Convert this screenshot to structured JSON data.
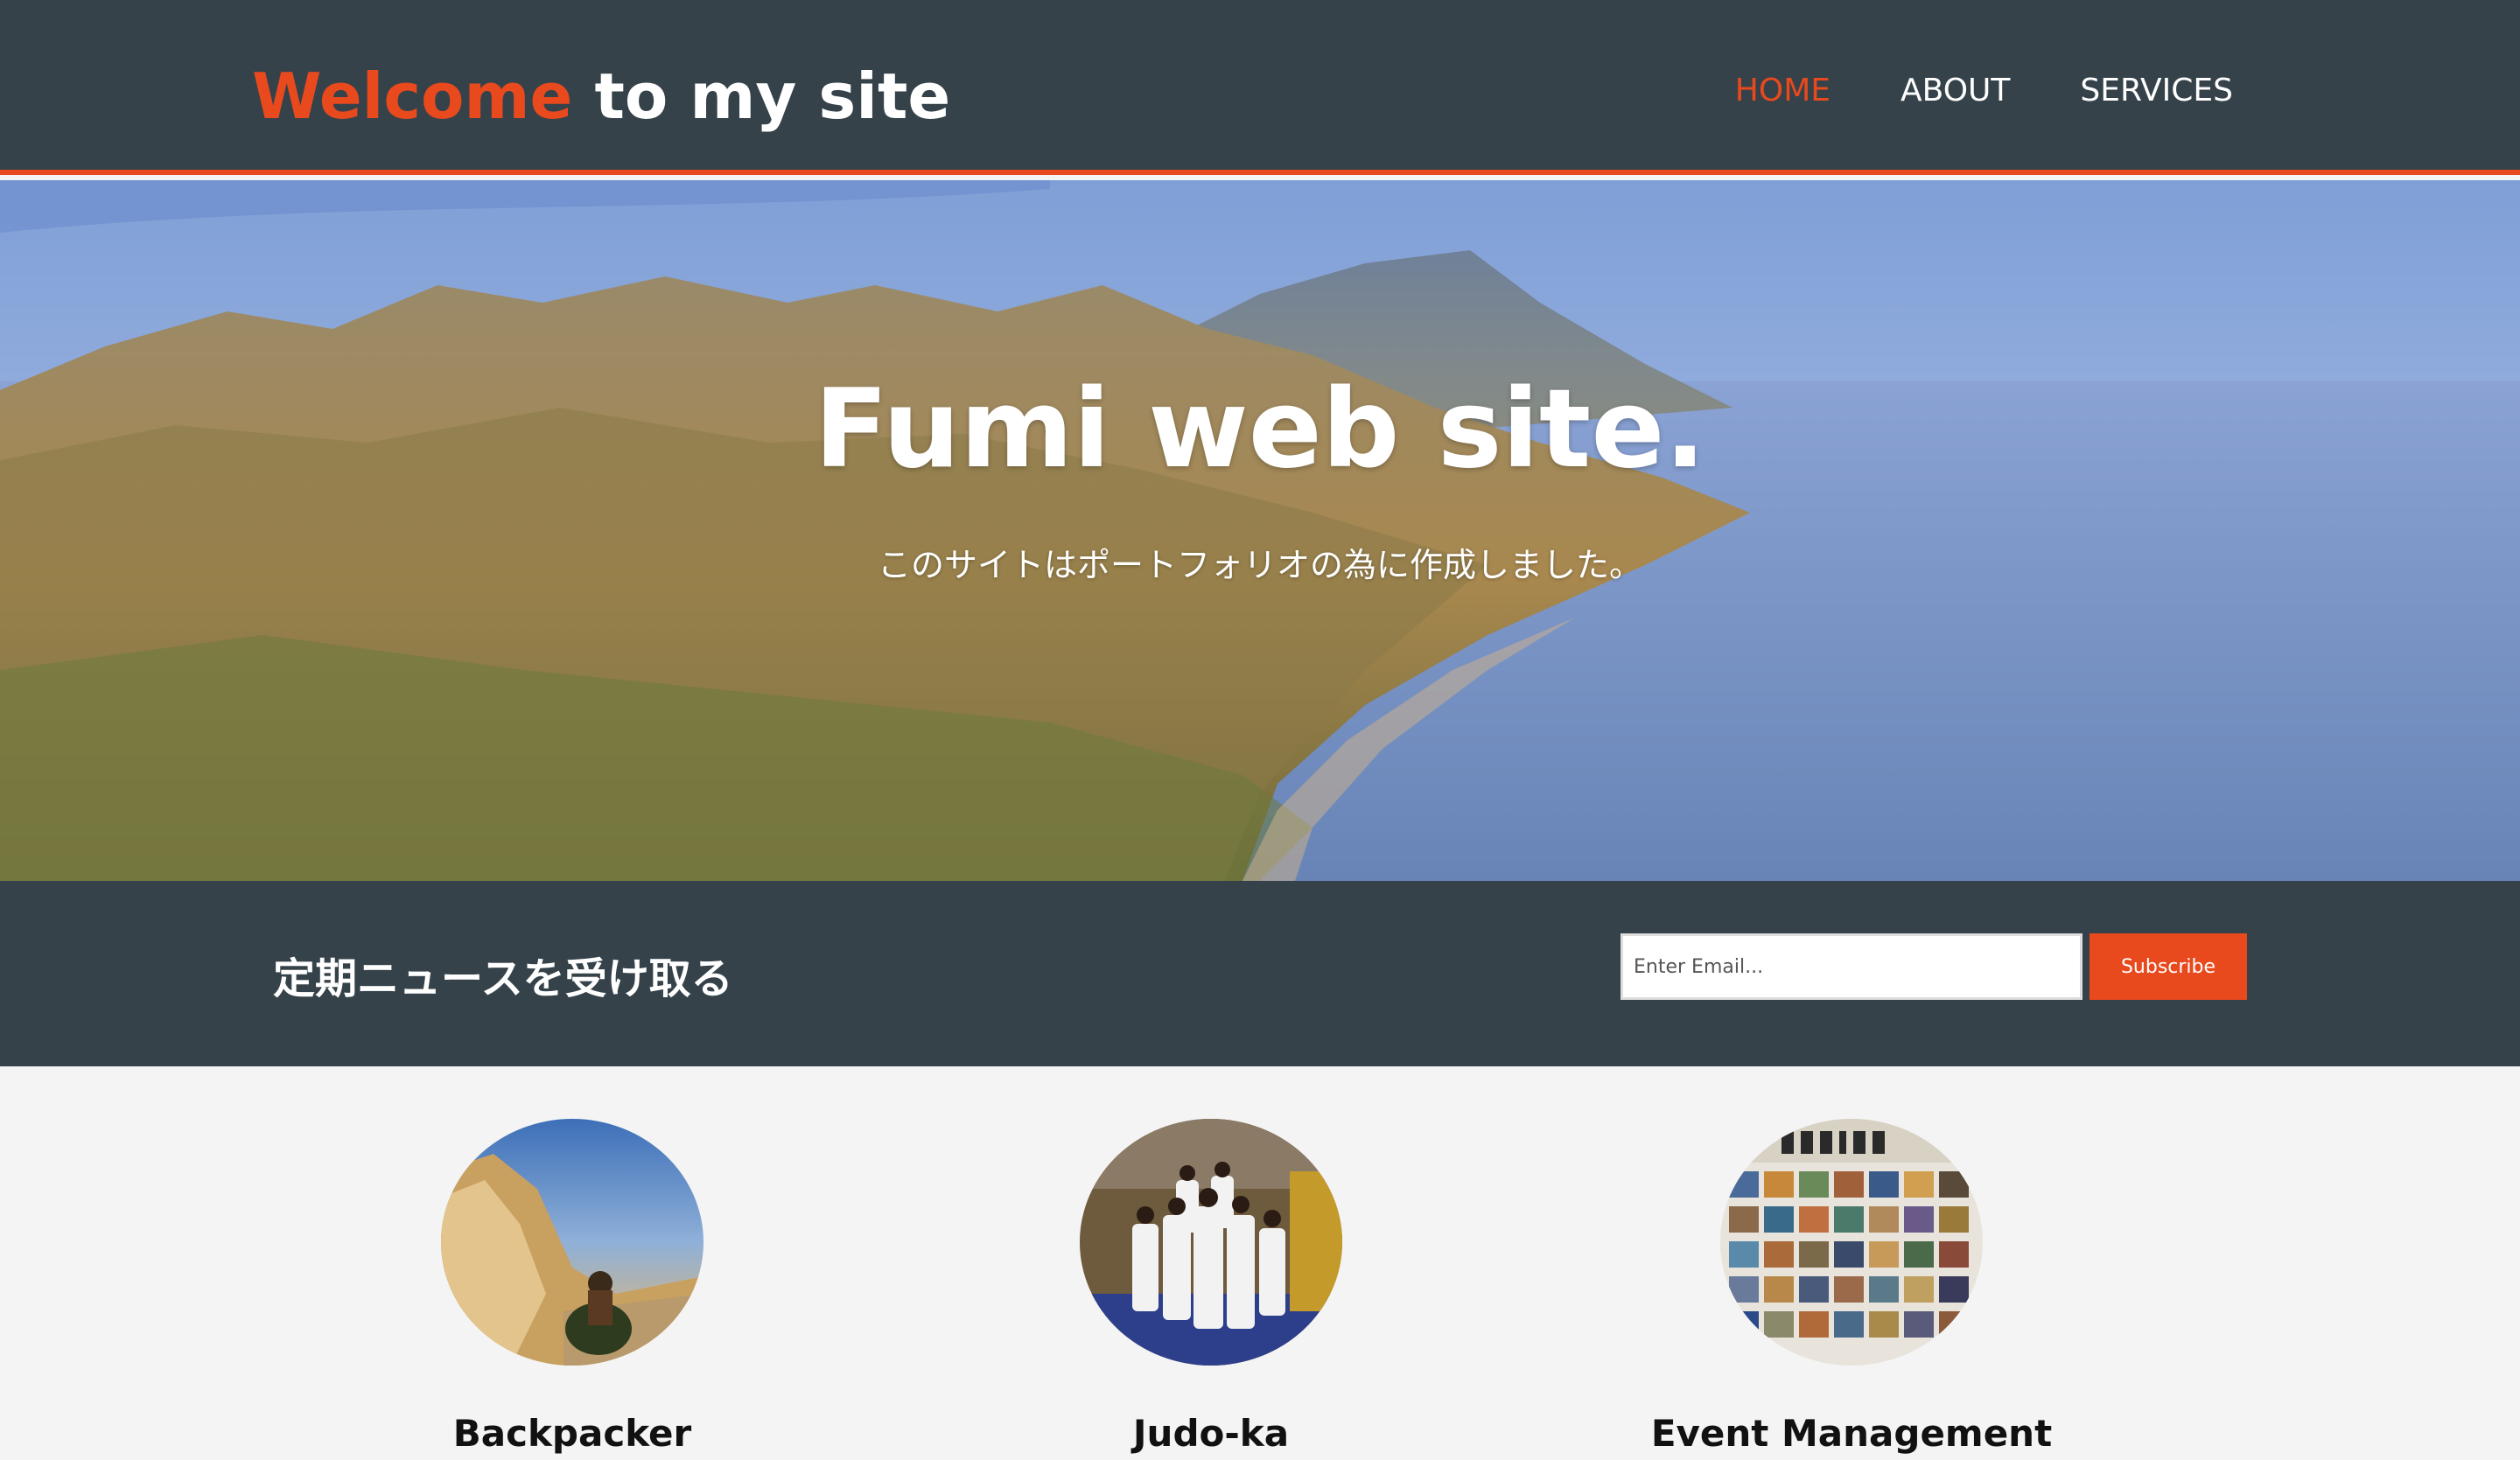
{
  "header": {
    "logo_highlight": "Welcome",
    "logo_rest": " to my site",
    "nav": [
      {
        "label": "HOME",
        "current": true
      },
      {
        "label": "ABOUT",
        "current": false
      },
      {
        "label": "SERVICES",
        "current": false
      }
    ]
  },
  "showcase": {
    "title": "Fumi web site.",
    "subtitle": "このサイトはポートフォリオの為に作成しました。"
  },
  "newsletter": {
    "heading": "定期ニュースを受け取る",
    "email_placeholder": "Enter Email...",
    "subscribe_label": "Subscribe"
  },
  "boxes": [
    {
      "title": "Backpacker",
      "icon": "backpacker-photo"
    },
    {
      "title": "Judo-ka",
      "icon": "judo-team-photo"
    },
    {
      "title": "Event Management",
      "icon": "photo-exhibition-photo"
    }
  ],
  "colors": {
    "accent": "#e8491d",
    "dark": "#35424a",
    "light_bg": "#f4f4f4"
  }
}
